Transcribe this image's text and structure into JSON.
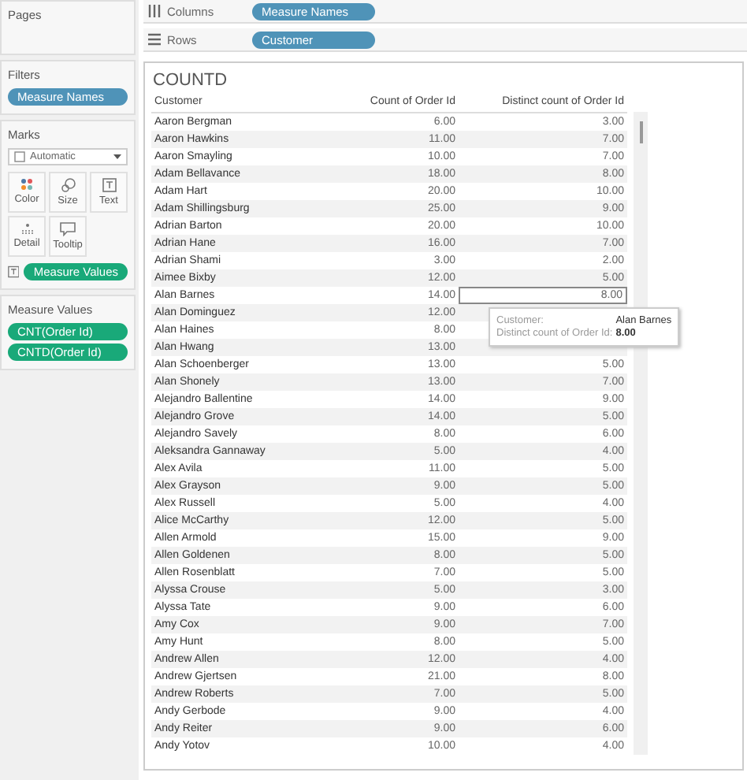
{
  "pages": {
    "title": "Pages"
  },
  "filters": {
    "title": "Filters",
    "pills": [
      {
        "label": "Measure Names",
        "kind": "dimension"
      }
    ]
  },
  "marks": {
    "title": "Marks",
    "mark_type": "Automatic",
    "cards": [
      {
        "label": "Color",
        "kind": "color"
      },
      {
        "label": "Size",
        "kind": "size"
      },
      {
        "label": "Text",
        "kind": "text"
      },
      {
        "label": "Detail",
        "kind": "detail"
      },
      {
        "label": "Tooltip",
        "kind": "tooltip"
      }
    ],
    "pills": [
      {
        "label": "Measure Values",
        "kind": "measure"
      }
    ]
  },
  "measure_values": {
    "title": "Measure Values",
    "pills": [
      {
        "label": "CNT(Order Id)",
        "kind": "measure"
      },
      {
        "label": "CNTD(Order Id)",
        "kind": "measure"
      }
    ]
  },
  "shelves": [
    {
      "label": "Columns",
      "kind": "columns",
      "pills": [
        {
          "label": "Measure Names",
          "kind": "dimension"
        }
      ]
    },
    {
      "label": "Rows",
      "kind": "rows",
      "pills": [
        {
          "label": "Customer",
          "kind": "dimension"
        }
      ]
    }
  ],
  "view": {
    "title": "COUNTD",
    "columns": [
      "Customer",
      "Count of Order Id",
      "Distinct count of Order Id"
    ],
    "rows": [
      {
        "cells": [
          "Aaron Bergman",
          "6.00",
          "3.00"
        ],
        "selected": false
      },
      {
        "cells": [
          "Aaron Hawkins",
          "11.00",
          "7.00"
        ],
        "selected": false
      },
      {
        "cells": [
          "Aaron Smayling",
          "10.00",
          "7.00"
        ],
        "selected": false
      },
      {
        "cells": [
          "Adam Bellavance",
          "18.00",
          "8.00"
        ],
        "selected": false
      },
      {
        "cells": [
          "Adam Hart",
          "20.00",
          "10.00"
        ],
        "selected": false
      },
      {
        "cells": [
          "Adam Shillingsburg",
          "25.00",
          "9.00"
        ],
        "selected": false
      },
      {
        "cells": [
          "Adrian Barton",
          "20.00",
          "10.00"
        ],
        "selected": false
      },
      {
        "cells": [
          "Adrian Hane",
          "16.00",
          "7.00"
        ],
        "selected": false
      },
      {
        "cells": [
          "Adrian Shami",
          "3.00",
          "2.00"
        ],
        "selected": false
      },
      {
        "cells": [
          "Aimee Bixby",
          "12.00",
          "5.00"
        ],
        "selected": false
      },
      {
        "cells": [
          "Alan Barnes",
          "14.00",
          "8.00"
        ],
        "selected": true
      },
      {
        "cells": [
          "Alan Dominguez",
          "12.00"
        ],
        "selected": false
      },
      {
        "cells": [
          "Alan Haines",
          "8.00"
        ],
        "selected": false
      },
      {
        "cells": [
          "Alan Hwang",
          "13.00"
        ],
        "selected": false
      },
      {
        "cells": [
          "Alan Schoenberger",
          "13.00",
          "5.00"
        ],
        "selected": false
      },
      {
        "cells": [
          "Alan Shonely",
          "13.00",
          "7.00"
        ],
        "selected": false
      },
      {
        "cells": [
          "Alejandro Ballentine",
          "14.00",
          "9.00"
        ],
        "selected": false
      },
      {
        "cells": [
          "Alejandro Grove",
          "14.00",
          "5.00"
        ],
        "selected": false
      },
      {
        "cells": [
          "Alejandro Savely",
          "8.00",
          "6.00"
        ],
        "selected": false
      },
      {
        "cells": [
          "Aleksandra Gannaway",
          "5.00",
          "4.00"
        ],
        "selected": false
      },
      {
        "cells": [
          "Alex Avila",
          "11.00",
          "5.00"
        ],
        "selected": false
      },
      {
        "cells": [
          "Alex Grayson",
          "9.00",
          "5.00"
        ],
        "selected": false
      },
      {
        "cells": [
          "Alex Russell",
          "5.00",
          "4.00"
        ],
        "selected": false
      },
      {
        "cells": [
          "Alice McCarthy",
          "12.00",
          "5.00"
        ],
        "selected": false
      },
      {
        "cells": [
          "Allen Armold",
          "15.00",
          "9.00"
        ],
        "selected": false
      },
      {
        "cells": [
          "Allen Goldenen",
          "8.00",
          "5.00"
        ],
        "selected": false
      },
      {
        "cells": [
          "Allen Rosenblatt",
          "7.00",
          "5.00"
        ],
        "selected": false
      },
      {
        "cells": [
          "Alyssa Crouse",
          "5.00",
          "3.00"
        ],
        "selected": false
      },
      {
        "cells": [
          "Alyssa Tate",
          "9.00",
          "6.00"
        ],
        "selected": false
      },
      {
        "cells": [
          "Amy Cox",
          "9.00",
          "7.00"
        ],
        "selected": false
      },
      {
        "cells": [
          "Amy Hunt",
          "8.00",
          "5.00"
        ],
        "selected": false
      },
      {
        "cells": [
          "Andrew Allen",
          "12.00",
          "4.00"
        ],
        "selected": false
      },
      {
        "cells": [
          "Andrew Gjertsen",
          "21.00",
          "8.00"
        ],
        "selected": false
      },
      {
        "cells": [
          "Andrew Roberts",
          "7.00",
          "5.00"
        ],
        "selected": false
      },
      {
        "cells": [
          "Andy Gerbode",
          "9.00",
          "4.00"
        ],
        "selected": false
      },
      {
        "cells": [
          "Andy Reiter",
          "9.00",
          "6.00"
        ],
        "selected": false
      },
      {
        "cells": [
          "Andy Yotov",
          "10.00",
          "4.00"
        ],
        "selected": false
      }
    ]
  },
  "tooltip": {
    "rows": [
      {
        "label": "Customer:",
        "value": "Alan Barnes"
      },
      {
        "label": "Distinct count of Order Id:",
        "value": "8.00"
      }
    ]
  }
}
